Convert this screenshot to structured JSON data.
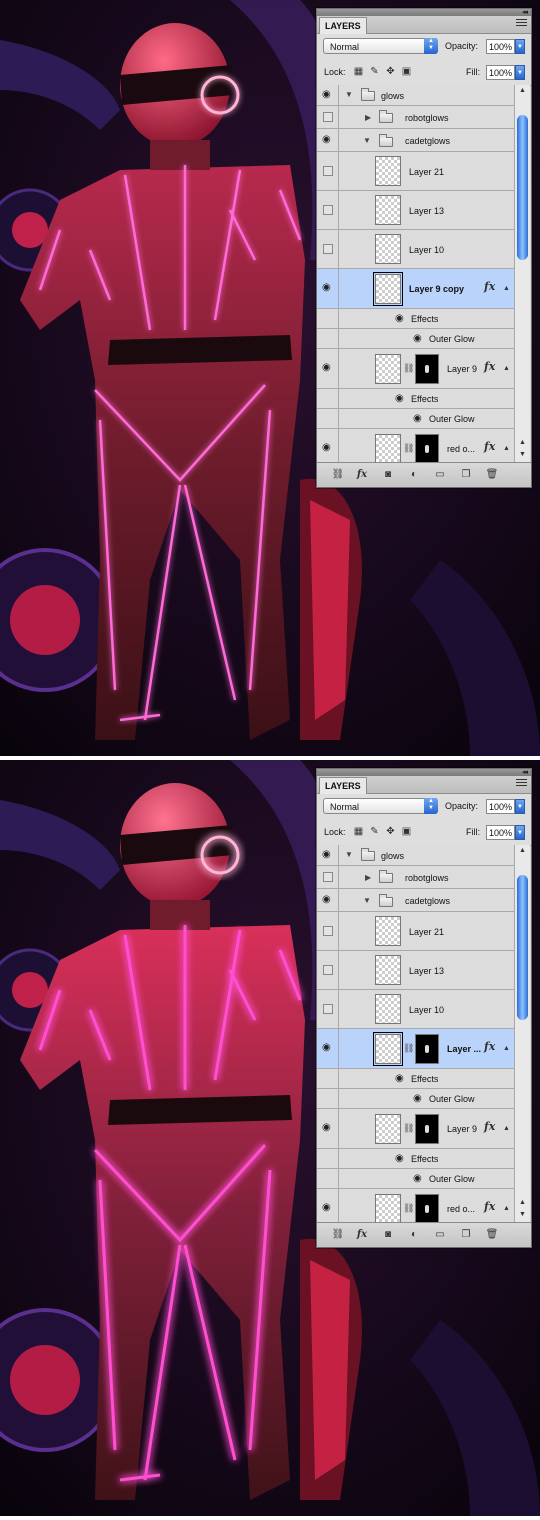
{
  "panel": {
    "tab": "LAYERS",
    "collapse_glyph": "◂◂",
    "blend_mode": "Normal",
    "opacity_label": "Opacity:",
    "opacity_value": "100%",
    "lock_label": "Lock:",
    "fill_label": "Fill:",
    "fill_value": "100%"
  },
  "top_state": {
    "rows": [
      {
        "name": "glows"
      },
      {
        "name": "robotglows"
      },
      {
        "name": "cadetglows"
      },
      {
        "name": "Layer 21"
      },
      {
        "name": "Layer 13"
      },
      {
        "name": "Layer 10"
      },
      {
        "name": "Layer 9 copy"
      },
      {
        "name": "Effects"
      },
      {
        "name": "Outer Glow"
      },
      {
        "name": "Layer 9"
      },
      {
        "name": "Effects"
      },
      {
        "name": "Outer Glow"
      },
      {
        "name": "red o..."
      }
    ]
  },
  "bottom_state": {
    "rows": [
      {
        "name": "glows"
      },
      {
        "name": "robotglows"
      },
      {
        "name": "cadetglows"
      },
      {
        "name": "Layer 21"
      },
      {
        "name": "Layer 13"
      },
      {
        "name": "Layer 10"
      },
      {
        "name": "Layer ..."
      },
      {
        "name": "Effects"
      },
      {
        "name": "Outer Glow"
      },
      {
        "name": "Layer 9"
      },
      {
        "name": "Effects"
      },
      {
        "name": "Outer Glow"
      },
      {
        "name": "red o..."
      }
    ]
  },
  "icons": {
    "eye": "eye-icon",
    "folder": "folder-icon",
    "fx": "fx-icon",
    "chain": "link-icon"
  },
  "colors": {
    "accent_glow": "#ff3dbd",
    "selection": "#b9d3fb",
    "background": "#0b0610"
  }
}
